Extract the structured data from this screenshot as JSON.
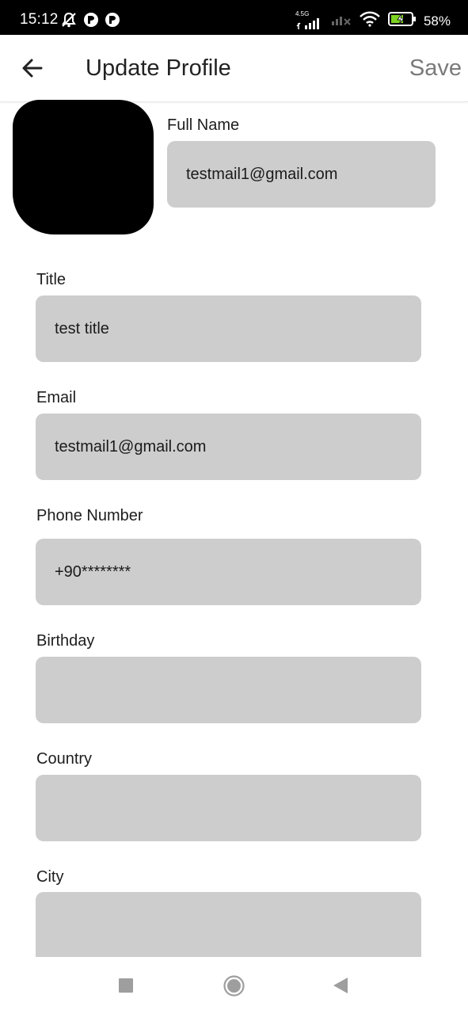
{
  "status_bar": {
    "time": "15:12",
    "network": "4.5G",
    "battery": "58%"
  },
  "app_bar": {
    "title": "Update Profile",
    "save_label": "Save"
  },
  "form": {
    "full_name": {
      "label": "Full Name",
      "value": "testmail1@gmail.com"
    },
    "title": {
      "label": "Title",
      "value": "test title"
    },
    "email": {
      "label": "Email",
      "value": "testmail1@gmail.com"
    },
    "phone": {
      "label": "Phone Number",
      "value": "+90********"
    },
    "birthday": {
      "label": "Birthday",
      "value": ""
    },
    "country": {
      "label": "Country",
      "value": ""
    },
    "city": {
      "label": "City",
      "value": ""
    }
  },
  "icons": {
    "back": "arrow-left-icon",
    "nav_recents": "square-icon",
    "nav_home": "circle-icon",
    "nav_back": "triangle-back-icon"
  },
  "colors": {
    "status_bar_bg": "#000000",
    "field_bg": "#cdcdcd",
    "save_text": "#7a7a7a",
    "battery_charge": "#7ed321"
  }
}
